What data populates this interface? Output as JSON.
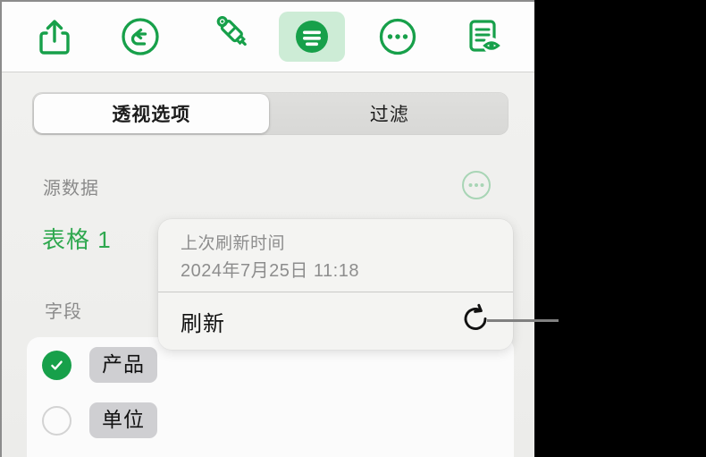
{
  "toolbar": {
    "buttons": [
      {
        "name": "share-icon",
        "label": "共享",
        "active": false
      },
      {
        "name": "undo-icon",
        "label": "撤销",
        "active": false
      },
      {
        "name": "paintbrush-icon",
        "label": "格式刷",
        "active": false
      },
      {
        "name": "format-icon",
        "label": "格式",
        "active": true
      },
      {
        "name": "more-icon",
        "label": "更多",
        "active": false
      },
      {
        "name": "document-view-icon",
        "label": "文稿",
        "active": false
      }
    ]
  },
  "tabs": {
    "items": [
      {
        "label": "透视选项",
        "selected": true
      },
      {
        "label": "过滤",
        "selected": false
      }
    ]
  },
  "source": {
    "label": "源数据",
    "table_name": "表格 1",
    "more_button_name": "source-more-button"
  },
  "fields": {
    "label": "字段",
    "items": [
      {
        "label": "产品",
        "checked": true
      },
      {
        "label": "单位",
        "checked": false
      }
    ]
  },
  "popover": {
    "refresh_label": "上次刷新时间",
    "refresh_time": "2024年7月25日 11:18",
    "action_label": "刷新",
    "action_icon": "refresh-icon"
  },
  "colors": {
    "accent_green": "#2fa84f",
    "toolbar_icon_green": "#17a04a",
    "active_bg_green": "#cdecd6",
    "panel_bg": "#efefed",
    "chip_gray": "#cfcfd2",
    "muted_text": "#8a8a8a",
    "callout_line": "#808080"
  }
}
